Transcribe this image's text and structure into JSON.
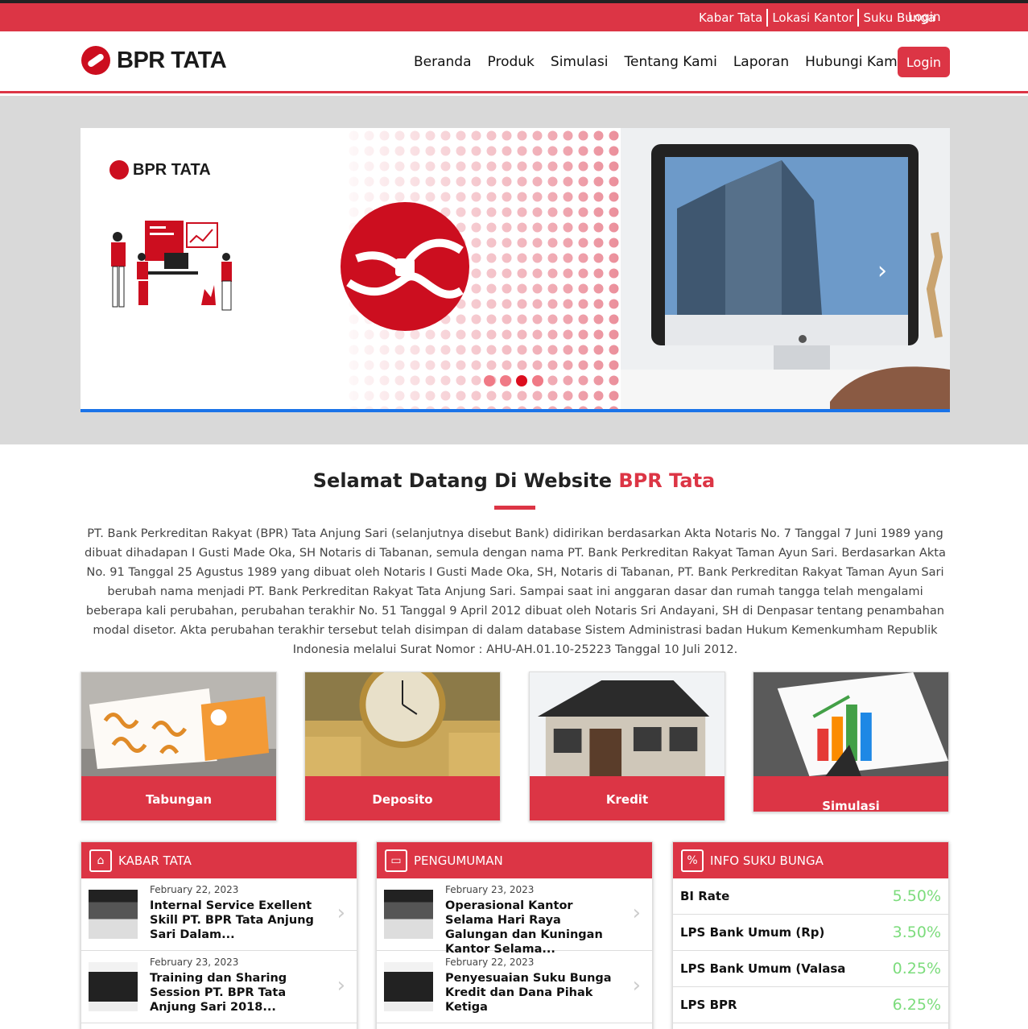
{
  "topbar": {
    "links": [
      "Kabar Tata",
      "Lokasi Kantor",
      "Suku Bunga"
    ],
    "login": "Login"
  },
  "brand": {
    "name": "BPR TATA"
  },
  "nav": {
    "items": [
      "Beranda",
      "Produk",
      "Simulasi",
      "Tentang Kami",
      "Laporan",
      "Hubungi Kami"
    ],
    "login": "Login"
  },
  "hero": {
    "logo_text": "BPR TATA",
    "active_slide": 3,
    "slide_count": 4
  },
  "welcome": {
    "title_part1": "Selamat Datang Di Website",
    "title_part2": "BPR Tata",
    "text": "PT. Bank Perkreditan Rakyat (BPR) Tata Anjung Sari (selanjutnya disebut Bank) didirikan berdasarkan Akta Notaris No. 7 Tanggal 7 Juni 1989 yang dibuat dihadapan I Gusti Made Oka, SH Notaris di Tabanan, semula dengan nama PT. Bank Perkreditan Rakyat Taman Ayun Sari. Berdasarkan Akta No. 91 Tanggal 25 Agustus 1989 yang dibuat oleh Notaris I Gusti Made Oka, SH, Notaris di Tabanan, PT. Bank Perkreditan Rakyat Taman Ayun Sari berubah nama menjadi PT. Bank Perkreditan Rakyat Tata Anjung Sari. Sampai saat ini anggaran dasar dan rumah tangga telah mengalami beberapa kali perubahan, perubahan terakhir No. 51 Tanggal 9 April 2012 dibuat oleh Notaris Sri Andayani, SH di Denpasar tentang penambahan modal disetor. Akta perubahan terakhir tersebut telah disimpan di dalam database Sistem Administrasi badan Hukum Kemenkumham Republik Indonesia melalui Surat Nomor : AHU-AH.01.10-25223 Tanggal 10 Juli 2012."
  },
  "products": [
    "Tabungan",
    "Deposito",
    "Kredit",
    "Simulasi"
  ],
  "kabar": {
    "title": "KABAR TATA",
    "items": [
      {
        "date": "February 22, 2023",
        "title": "Internal Service Exellent Skill PT. BPR Tata Anjung Sari Dalam..."
      },
      {
        "date": "February 23, 2023",
        "title": "Training dan Sharing Session PT. BPR Tata Anjung Sari 2018..."
      }
    ]
  },
  "pengumuman": {
    "title": "PENGUMUMAN",
    "items": [
      {
        "date": "February 23, 2023",
        "title": "Operasional Kantor Selama Hari Raya Galungan dan Kuningan Kantor Selama..."
      },
      {
        "date": "February 22, 2023",
        "title": "Penyesuaian Suku Bunga Kredit dan Dana Pihak Ketiga"
      }
    ]
  },
  "suku_bunga": {
    "title": "INFO SUKU BUNGA",
    "rates": [
      {
        "name": "BI Rate",
        "value": "5.50%"
      },
      {
        "name": "LPS Bank Umum (Rp)",
        "value": "3.50%"
      },
      {
        "name": "LPS Bank Umum (Valasa",
        "value": "0.25%"
      },
      {
        "name": "LPS BPR",
        "value": "6.25%"
      }
    ]
  },
  "colors": {
    "brand": "#dc3545",
    "rate": "#7cdc7c",
    "slider_bar": "#1a73e8"
  }
}
